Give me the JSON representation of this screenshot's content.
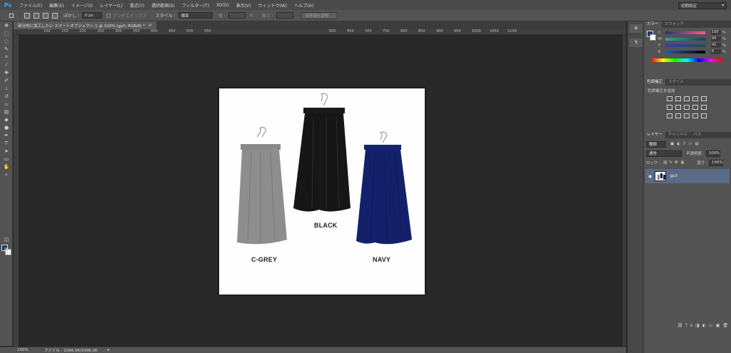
{
  "app": {
    "logo": "Ps"
  },
  "menu": [
    "ファイル(F)",
    "編集(E)",
    "イメージ(I)",
    "レイヤー(L)",
    "書式(Y)",
    "選択範囲(S)",
    "フィルター(T)",
    "3D(D)",
    "表示(V)",
    "ウィンドウ(W)",
    "ヘルプ(H)"
  ],
  "options": {
    "feather_label": "ぼかし :",
    "feather_value": "0 px",
    "antialias_label": "アンチエイリアス",
    "style_label": "スタイル :",
    "style_value": "標準",
    "width_label": "幅 :",
    "height_label": "高さ :",
    "refine_button": "境界線を調整...",
    "workspace": "初期設定"
  },
  "document": {
    "tab_title": "部分的に加工したい スマートオブジェクト-1 @ 100% (gp3, RGB/8) *",
    "labels": {
      "grey": "C-GREY",
      "black": "BLACK",
      "navy": "NAVY"
    }
  },
  "ruler": {
    "top_ticks": [
      "100",
      "150",
      "200",
      "250",
      "300",
      "350",
      "400",
      "450",
      "500",
      "550",
      "600",
      "650",
      "700",
      "750",
      "800",
      "850",
      "900",
      "950",
      "1000",
      "1050",
      "1100"
    ]
  },
  "status": {
    "zoom": "100%",
    "file_info": "ファイル : 1006.0K/1006.0K"
  },
  "panels": {
    "color_tabs": [
      "カラー",
      "スウォッチ"
    ],
    "color_channels": [
      {
        "ch": "C",
        "value": "100",
        "color": "#00a0e9"
      },
      {
        "ch": "M",
        "value": "94",
        "color": "#e4007f"
      },
      {
        "ch": "Y",
        "value": "42",
        "color": "#fff100"
      },
      {
        "ch": "K",
        "value": "6",
        "color": "#000000"
      }
    ],
    "adjust_tabs": [
      "色調補正",
      "スタイル"
    ],
    "adjust_title": "色調補正を追加",
    "layers_tabs": [
      "レイヤー",
      "チャンネル",
      "パス"
    ],
    "kind_value": "種類",
    "blend_mode": "通常",
    "opacity_label": "不透明度 :",
    "opacity_value": "100%",
    "lock_label": "ロック :",
    "fill_label": "塗り :",
    "fill_value": "100%",
    "layer_name": "gp3"
  },
  "colors": {
    "foreground": "#1c3a6e",
    "background": "#ffffff",
    "accent": "#31a8ff"
  }
}
